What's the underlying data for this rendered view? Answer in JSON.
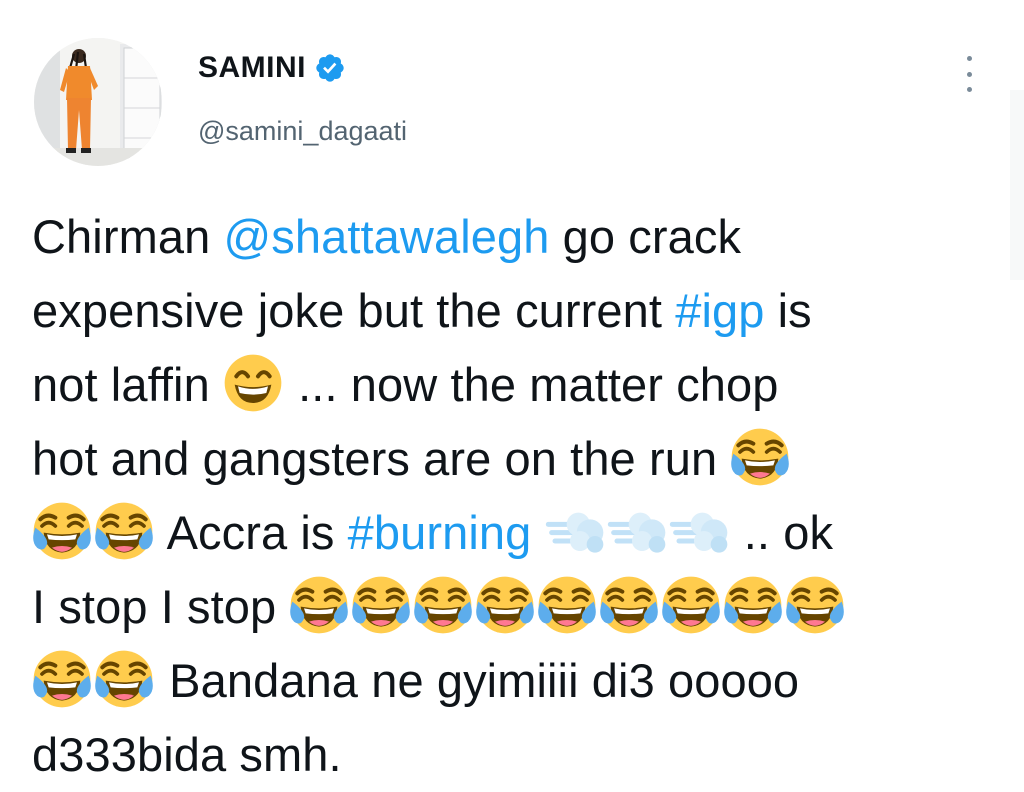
{
  "tweet": {
    "author": {
      "display_name": "SAMINI",
      "handle": "@samini_dagaati",
      "verified": true,
      "avatar_icon": "avatar-photo"
    },
    "menu_icon": "more-vertical-icon",
    "colors": {
      "link": "#1d9bf0",
      "text": "#0f1419",
      "secondary": "#536471",
      "verified": "#1d9bf0"
    },
    "text": {
      "l1_a": "Chirman ",
      "l1_mention": "@shattawalegh",
      "l1_b": " go crack",
      "l2_a": "expensive joke but the current ",
      "l2_hashtag": "#igp",
      "l2_b": " is",
      "l3_a": "not laffin ",
      "l3_b": " ... now the matter chop",
      "l4_a": "hot and gangsters are on the run ",
      "l5_a": " Accra is ",
      "l5_hashtag": "#burning",
      "l5_b": " .. ok",
      "l6_a": "I stop I stop ",
      "l7_a": " Bandana ne gyimiiii di3 ooooo",
      "l8_a": "d333bida smh."
    },
    "emoji": {
      "grin": "grinning-face-with-smiling-eyes",
      "tears": "face-with-tears-of-joy",
      "dash": "dashing-away"
    }
  }
}
